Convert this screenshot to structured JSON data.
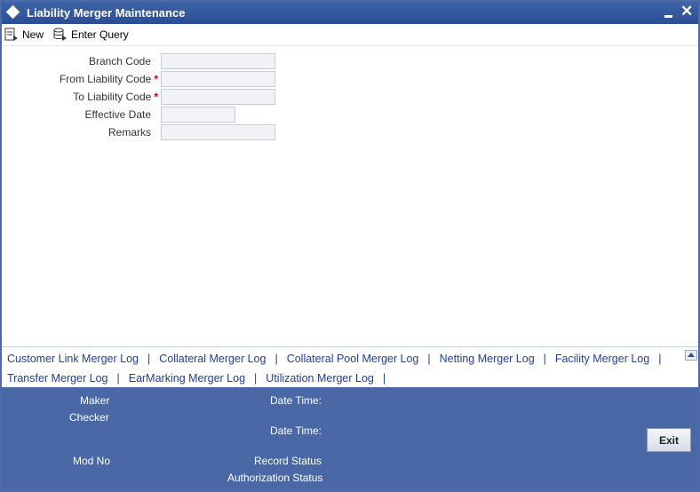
{
  "window": {
    "title": "Liability Merger Maintenance"
  },
  "toolbar": {
    "new_label": "New",
    "enter_query_label": "Enter Query"
  },
  "form": {
    "branch_code": {
      "label": "Branch Code",
      "value": ""
    },
    "from_liability_code": {
      "label": "From Liability Code",
      "required_mark": "*",
      "value": ""
    },
    "to_liability_code": {
      "label": "To Liability Code",
      "required_mark": "*",
      "value": ""
    },
    "effective_date": {
      "label": "Effective Date",
      "value": ""
    },
    "remarks": {
      "label": "Remarks",
      "value": ""
    }
  },
  "links": {
    "separator": "|",
    "items": [
      "Customer Link Merger Log",
      "Collateral Merger Log",
      "Collateral Pool Merger Log",
      "Netting Merger Log",
      "Facility Merger Log",
      "Transfer Merger Log",
      "EarMarking Merger Log",
      "Utilization Merger Log"
    ]
  },
  "footer": {
    "maker_label": "Maker",
    "checker_label": "Checker",
    "maker_datetime_label": "Date Time:",
    "checker_datetime_label": "Date Time:",
    "mod_no_label": "Mod No",
    "record_status_label": "Record Status",
    "authorization_status_label": "Authorization Status",
    "exit_label": "Exit"
  },
  "colors": {
    "titlebar": "#2a4d94",
    "footer": "#4a68a6",
    "link": "#1f3f9a",
    "required": "#cc0000"
  },
  "icons": {
    "title": "diamond-icon",
    "new": "new-document-icon",
    "enter_query": "query-icon",
    "minimize": "minimize-icon",
    "close": "close-icon",
    "scroll_up": "arrow-up-icon"
  }
}
